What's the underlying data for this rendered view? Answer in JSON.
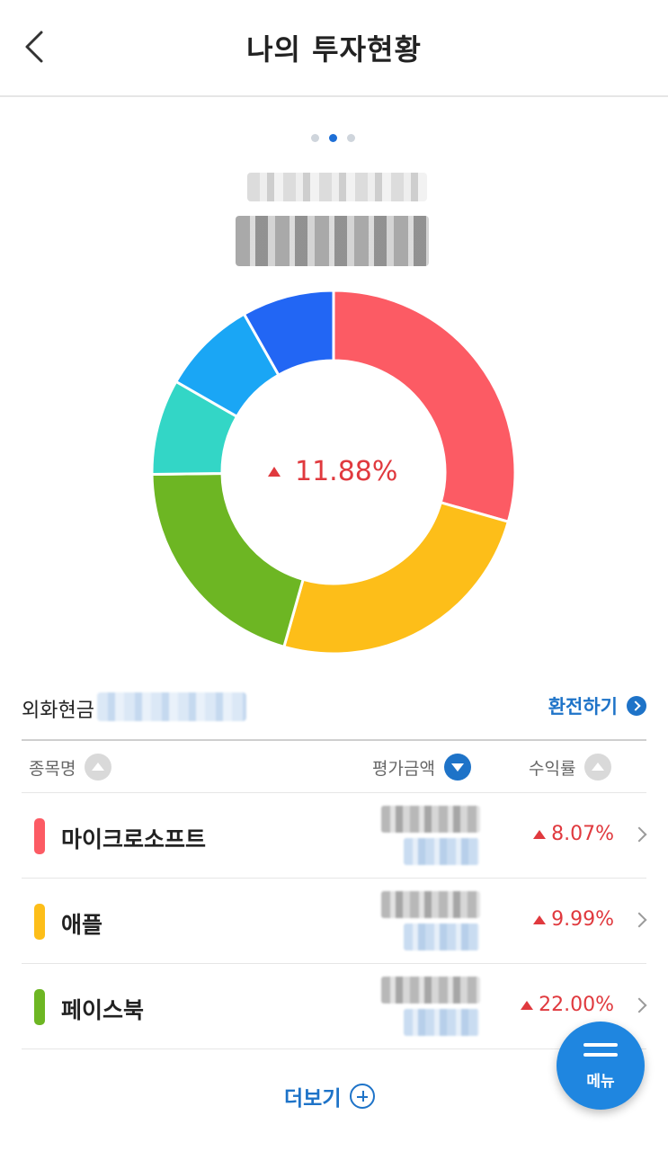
{
  "header": {
    "title": "나의 투자현황"
  },
  "pager": {
    "count": 3,
    "active_index": 1
  },
  "portfolio": {
    "return_rate": "11.88%",
    "return_direction": "up"
  },
  "chart_data": {
    "type": "pie",
    "style": "donut",
    "center_label": "11.88%",
    "slices": [
      {
        "color": "#fc5b64",
        "fraction": 0.294
      },
      {
        "color": "#fdbe19",
        "fraction": 0.25
      },
      {
        "color": "#6db623",
        "fraction": 0.204
      },
      {
        "color": "#33d6c6",
        "fraction": 0.085
      },
      {
        "color": "#1aa6f5",
        "fraction": 0.085
      },
      {
        "color": "#2266f4",
        "fraction": 0.082
      }
    ]
  },
  "cash": {
    "label": "외화현금",
    "exchange_label": "환전하기"
  },
  "table": {
    "columns": [
      {
        "label": "종목명",
        "sort": "asc-inactive"
      },
      {
        "label": "평가금액",
        "sort": "desc-active"
      },
      {
        "label": "수익률",
        "sort": "asc-inactive"
      }
    ],
    "rows": [
      {
        "name": "마이크로소프트",
        "color": "#fc5b64",
        "rate": "8.07%",
        "direction": "up"
      },
      {
        "name": "애플",
        "color": "#fdbe19",
        "rate": "9.99%",
        "direction": "up"
      },
      {
        "name": "페이스북",
        "color": "#6db623",
        "rate": "22.00%",
        "direction": "up"
      }
    ]
  },
  "more": {
    "label": "더보기"
  },
  "fab": {
    "label": "메뉴"
  },
  "colors": {
    "accent": "#1e73c8",
    "rise": "#e0393e"
  }
}
